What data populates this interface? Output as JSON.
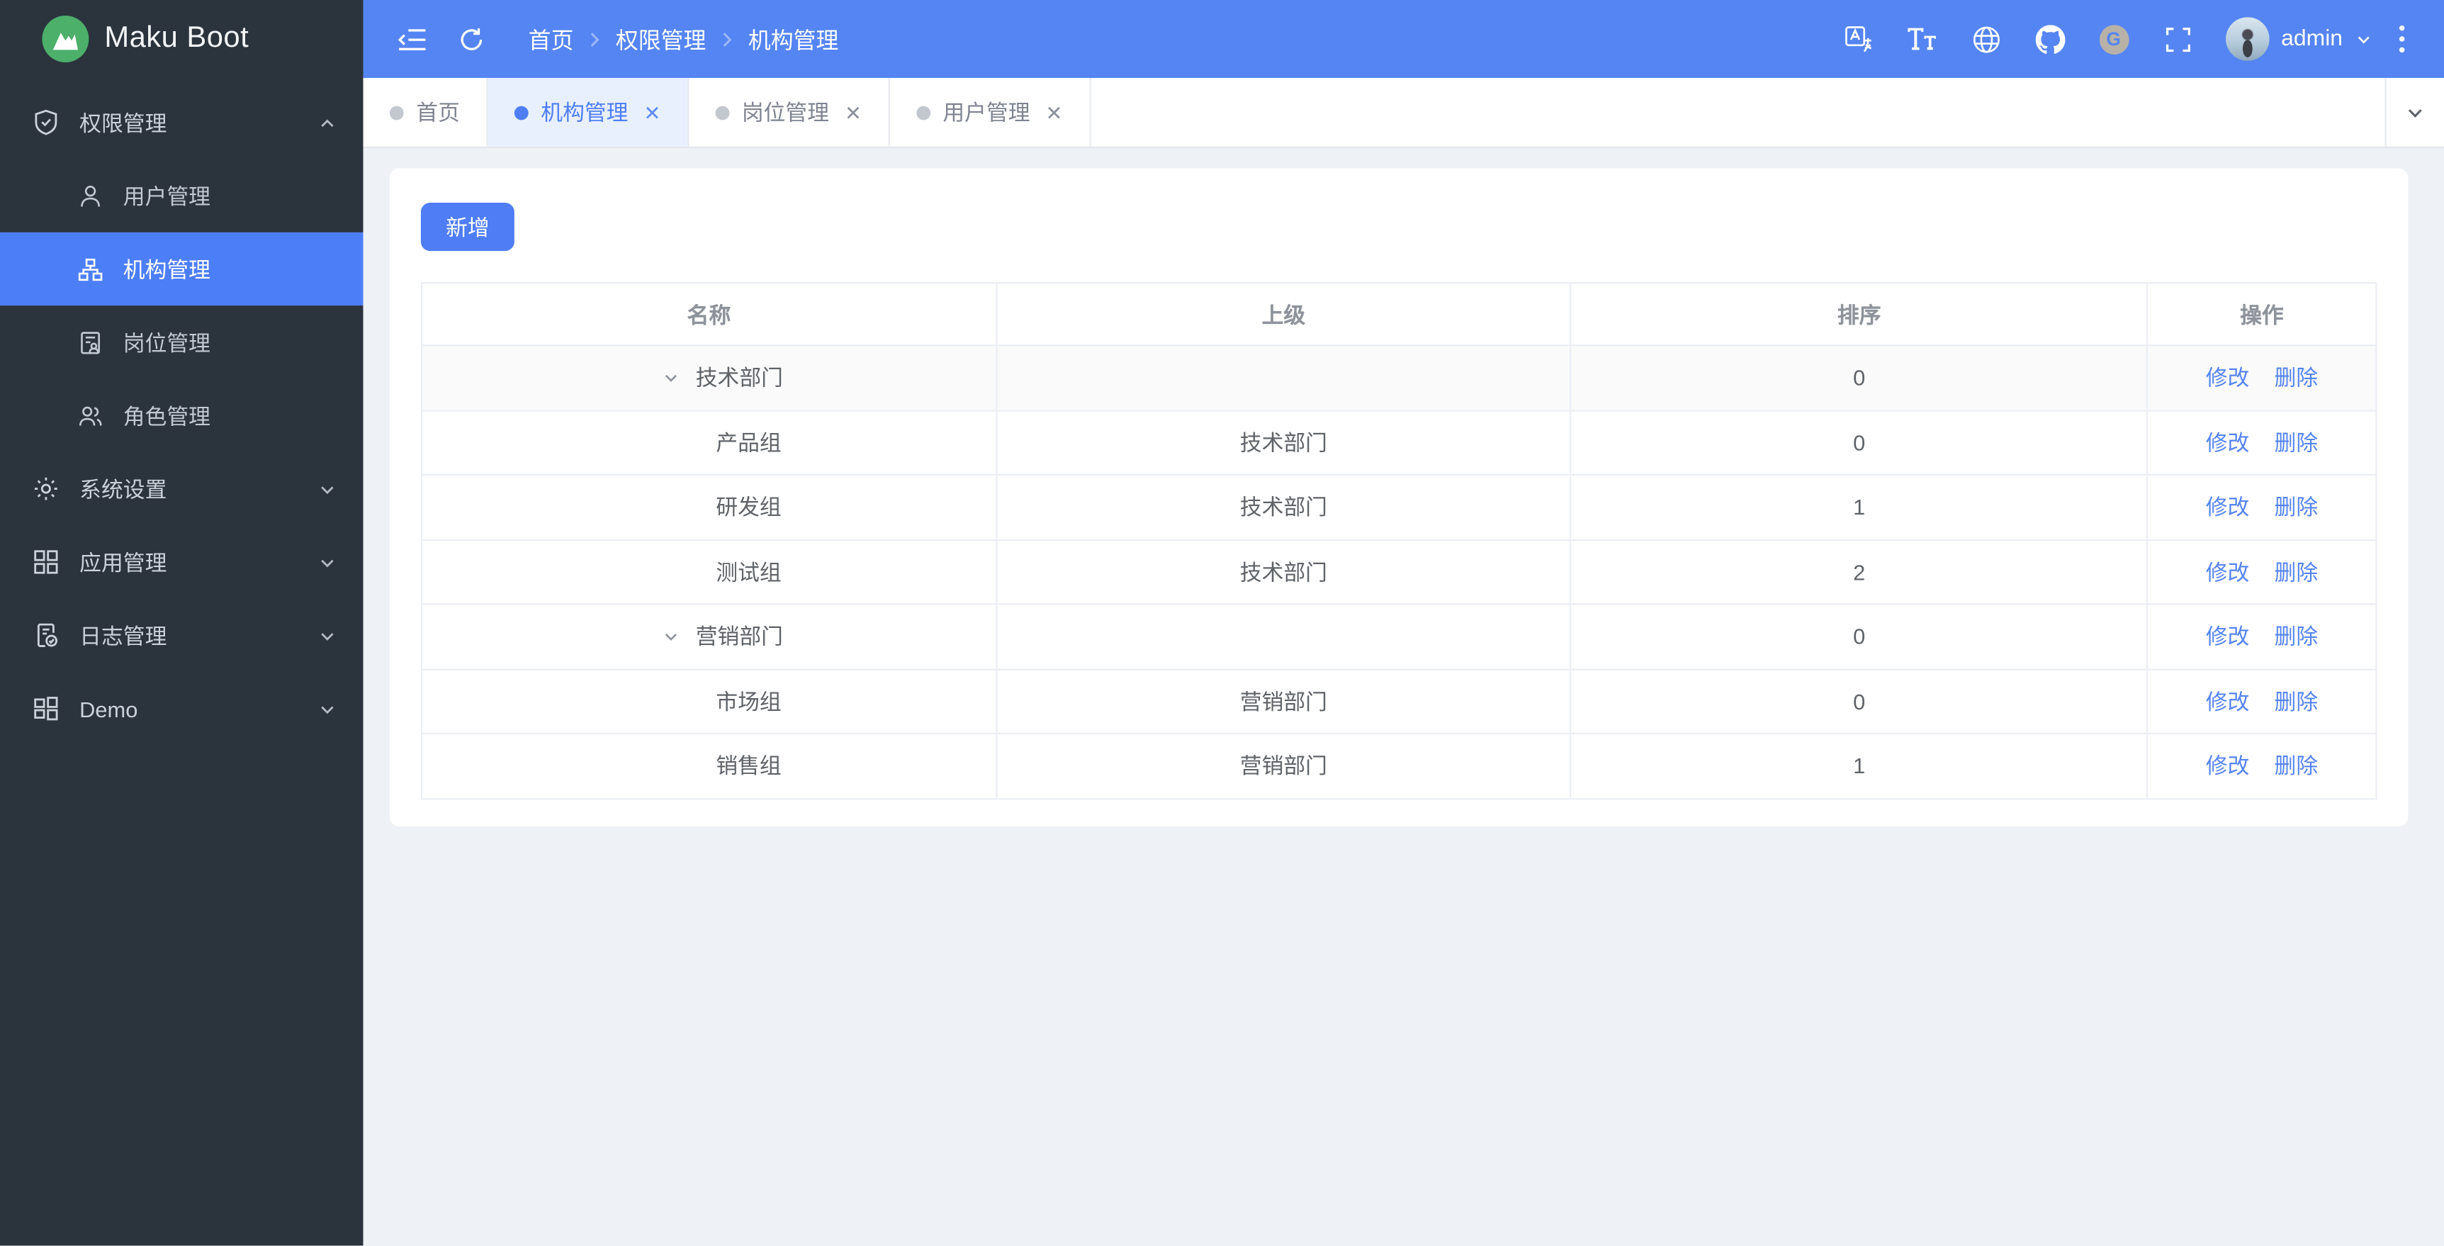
{
  "app": {
    "logo_text": "Maku Boot"
  },
  "colors": {
    "primary": "#4f7ef5",
    "header_bg": "#5585f2",
    "sidebar_bg": "#2b333d",
    "active_menu_bg": "#4c7ef8",
    "content_bg": "#eef1f5",
    "tab_active_bg": "#e9f0fd",
    "logo_green": "#4caf6a",
    "link_blue": "#5584f0"
  },
  "sidebar": {
    "groups": [
      {
        "label": "权限管理",
        "icon": "shield-check",
        "state": "expanded",
        "children": [
          {
            "label": "用户管理",
            "icon": "user",
            "active": false
          },
          {
            "label": "机构管理",
            "icon": "org-chart",
            "active": true
          },
          {
            "label": "岗位管理",
            "icon": "post-doc",
            "active": false
          },
          {
            "label": "角色管理",
            "icon": "users",
            "active": false
          }
        ]
      },
      {
        "label": "系统设置",
        "icon": "gear",
        "state": "collapsed"
      },
      {
        "label": "应用管理",
        "icon": "grid",
        "state": "collapsed"
      },
      {
        "label": "日志管理",
        "icon": "log-doc",
        "state": "collapsed"
      },
      {
        "label": "Demo",
        "icon": "apps",
        "state": "collapsed"
      }
    ]
  },
  "header": {
    "breadcrumb": [
      "首页",
      "权限管理",
      "机构管理"
    ],
    "username": "admin",
    "icons": [
      "menu-fold",
      "refresh",
      "language",
      "font-size",
      "globe",
      "github",
      "gitee",
      "fullscreen",
      "more"
    ],
    "gitee_glyph": "G",
    "font_size_glyph": "Tt"
  },
  "tabs": {
    "close_glyph": "✕",
    "items": [
      {
        "label": "首页",
        "closable": false,
        "active": false
      },
      {
        "label": "机构管理",
        "closable": true,
        "active": true
      },
      {
        "label": "岗位管理",
        "closable": true,
        "active": false
      },
      {
        "label": "用户管理",
        "closable": true,
        "active": false
      }
    ]
  },
  "main": {
    "add_button": "新增",
    "table": {
      "columns": [
        "名称",
        "上级",
        "排序",
        "操作"
      ],
      "action_edit": "修改",
      "action_delete": "删除",
      "rows": [
        {
          "name": "技术部门",
          "parent": "",
          "sort": "0",
          "level": 0,
          "expanded": true
        },
        {
          "name": "产品组",
          "parent": "技术部门",
          "sort": "0",
          "level": 1
        },
        {
          "name": "研发组",
          "parent": "技术部门",
          "sort": "1",
          "level": 1
        },
        {
          "name": "测试组",
          "parent": "技术部门",
          "sort": "2",
          "level": 1
        },
        {
          "name": "营销部门",
          "parent": "",
          "sort": "0",
          "level": 0,
          "expanded": true
        },
        {
          "name": "市场组",
          "parent": "营销部门",
          "sort": "0",
          "level": 1
        },
        {
          "name": "销售组",
          "parent": "营销部门",
          "sort": "1",
          "level": 1
        }
      ]
    }
  }
}
